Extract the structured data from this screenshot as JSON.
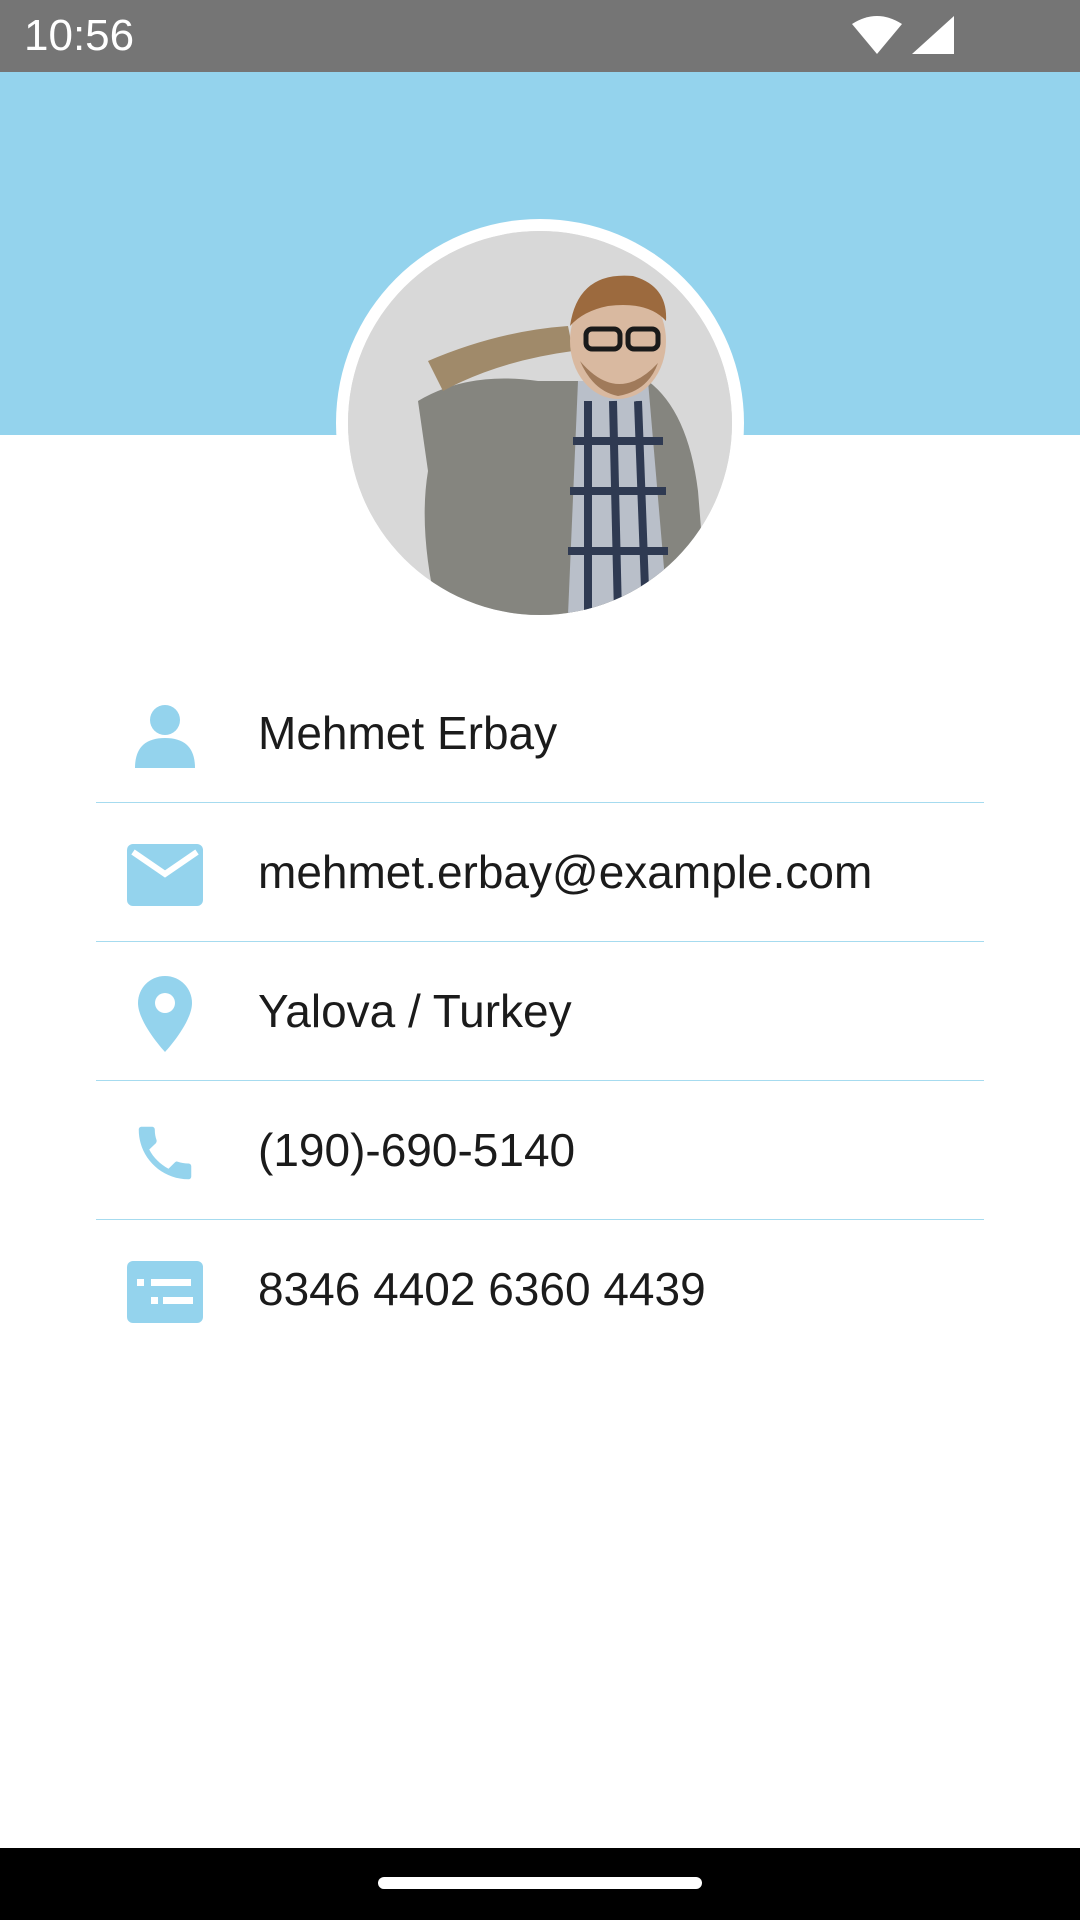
{
  "status_bar": {
    "time": "10:56",
    "icons": [
      "wifi-icon",
      "cellular-signal-icon"
    ]
  },
  "profile": {
    "avatar_alt": "profile photo"
  },
  "accent_color": "#94d3ed",
  "rows": [
    {
      "icon": "person-icon",
      "value": "Mehmet Erbay"
    },
    {
      "icon": "email-icon",
      "value": "mehmet.erbay@example.com"
    },
    {
      "icon": "location-pin-icon",
      "value": "Yalova / Turkey"
    },
    {
      "icon": "phone-icon",
      "value": "(190)-690-5140"
    },
    {
      "icon": "card-icon",
      "value": "8346 4402 6360 4439"
    }
  ]
}
